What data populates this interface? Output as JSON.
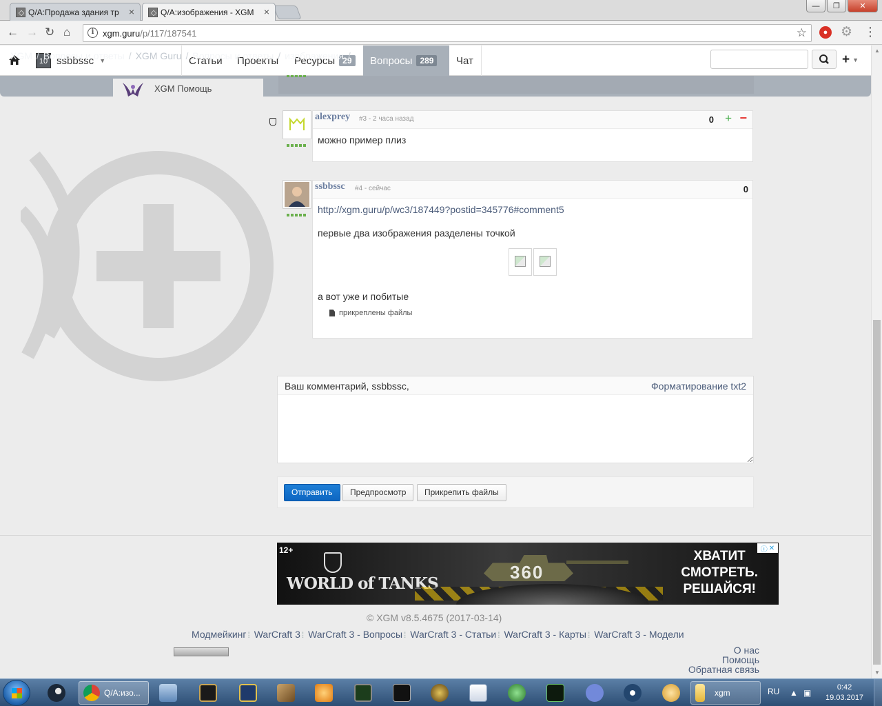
{
  "browser": {
    "tabs": [
      {
        "title": "Q/A:Продажа здания тр",
        "active": false
      },
      {
        "title": "Q/A:изображения - XGM",
        "active": true
      }
    ],
    "url_host": "xgm.guru",
    "url_path": "/p/117/187541",
    "abp_label": "ABP"
  },
  "site": {
    "user": "ssbbssc",
    "user_avatar_text": "10",
    "nav": [
      {
        "label": "Статьи"
      },
      {
        "label": "Проекты"
      },
      {
        "label": "Ресурсы",
        "badge": "29"
      },
      {
        "label": "Вопросы",
        "badge": "289",
        "active": true
      },
      {
        "label": "Чат"
      }
    ],
    "search_placeholder": "",
    "breadcrumb": [
      "XGM",
      "Вопросы и ответы",
      "XGM Guru",
      "Вопросы и ответы",
      "изображения"
    ],
    "xgm_help": "XGM Помощь"
  },
  "comments": [
    {
      "author": "alexprey",
      "meta": "#3 - 2 часа назад",
      "score": "0",
      "text": "можно пример плиз"
    },
    {
      "author": "ssbbssc",
      "meta": "#4 - сейчас",
      "score": "0",
      "link": "http://xgm.guru/p/wc3/187449?postid=345776#comment5",
      "p1": "первые два изображения разделены точкой",
      "p2": "а вот уже и побитые",
      "attach": "прикреплены файлы"
    }
  ],
  "form": {
    "label": "Ваш комментарий, ssbbssc,",
    "format": "Форматирование txt2",
    "submit": "Отправить",
    "preview": "Предпросмотр",
    "attach": "Прикрепить файлы"
  },
  "ad": {
    "age": "12+",
    "brand": "WORLD of TANKS",
    "center": "360",
    "slogan": [
      "ХВАТИТ",
      "СМОТРЕТЬ.",
      "РЕШАЙСЯ!"
    ]
  },
  "footer": {
    "copyright": "© XGM v8.5.4675 (2017-03-14)",
    "links": [
      "Модмейкинг",
      "WarCraft 3",
      "WarCraft 3 - Вопросы",
      "WarCraft 3 - Статьи",
      "WarCraft 3 - Карты",
      "WarCraft 3 - Модели"
    ],
    "right": [
      "О нас",
      "Помощь",
      "Обратная связь"
    ]
  },
  "taskbar": {
    "chrome_title": "Q/A:изо...",
    "folder_title": "xgm",
    "lang": "RU",
    "time": "0:42",
    "date": "19.03.2017"
  }
}
